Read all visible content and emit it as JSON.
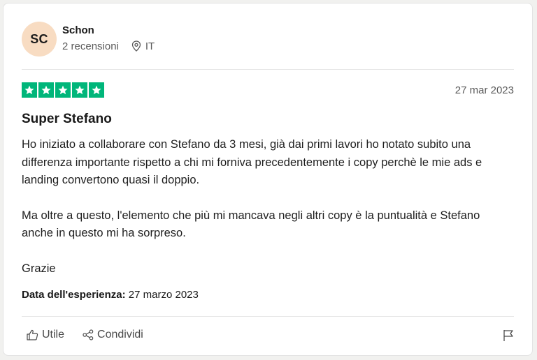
{
  "reviewer": {
    "initials": "SC",
    "name": "Schon",
    "reviews_count": "2 recensioni",
    "country": "IT",
    "avatar_color": "#f8dcc2"
  },
  "review": {
    "rating": 5,
    "max_rating": 5,
    "star_color": "#00b67a",
    "date": "27 mar 2023",
    "title": "Super Stefano",
    "paragraphs": [
      "Ho iniziato a collaborare con Stefano da 3 mesi, già dai primi lavori ho notato subito una differenza importante rispetto a chi mi forniva precedentemente i copy perchè le mie ads e landing convertono quasi il doppio.",
      "Ma oltre a questo, l'elemento che più mi mancava negli altri copy è la puntualità e Stefano anche in questo mi ha sorpreso.",
      "Grazie"
    ],
    "experience_label": "Data dell'esperienza:",
    "experience_date": "27 marzo 2023"
  },
  "actions": {
    "useful_label": "Utile",
    "share_label": "Condividi",
    "useful_icon": "thumbs-up-icon",
    "share_icon": "share-icon",
    "report_icon": "flag-icon"
  }
}
